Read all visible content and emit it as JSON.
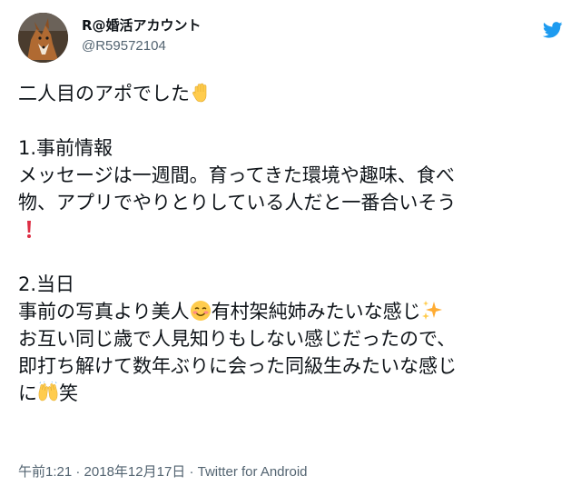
{
  "account": {
    "display_name": "R@婚活アカウント",
    "handle": "@R59572104",
    "avatar_icon": "fox-avatar-icon",
    "platform_icon": "twitter-bird-icon",
    "brand_color": "#1d9bf0"
  },
  "tweet": {
    "line1": "二人目のアポでした",
    "line1_emoji": "raised-hand-icon",
    "line3": "1.事前情報",
    "line4": "メッセージは一週間。育ってきた環境や趣味、食べ",
    "line5": "物、アプリでやりとりしている人だと一番合いそう",
    "line6_emoji": "exclamation-icon",
    "line8": "2.当日",
    "line9_a": "事前の写真より美人",
    "line9_emoji1": "smiling-blush-face-icon",
    "line9_b": "有村架純姉みたいな感じ",
    "line9_emoji2": "sparkles-icon",
    "line10": "お互い同じ歳で人見知りもしない感じだったので、",
    "line11": "即打ち解けて数年ぶりに会った同級生みたいな感じ",
    "line12_a": "に",
    "line12_emoji": "raising-hands-icon",
    "line12_b": "笑"
  },
  "meta": {
    "time": "午前1:21",
    "separator1": " · ",
    "date": "2018年12月17日",
    "separator2": " · ",
    "source": "Twitter for Android"
  },
  "colors": {
    "text": "#0f1419",
    "secondary": "#536471",
    "exclamation": "#e0245e"
  }
}
